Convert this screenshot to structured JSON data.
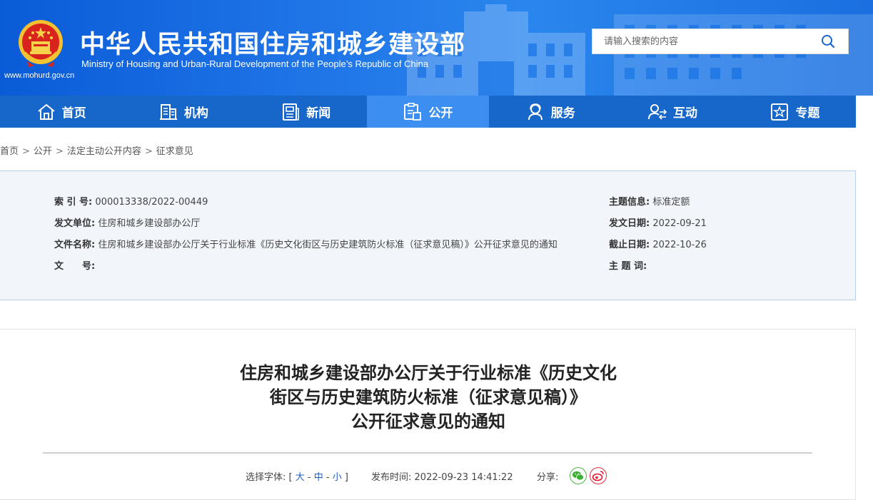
{
  "header": {
    "title": "中华人民共和国住房和城乡建设部",
    "subtitle": "Ministry of Housing and Urban-Rural Development of the People’s Republic of China",
    "url": "www.mohurd.gov.cn",
    "search_placeholder": "请输入搜索的内容"
  },
  "nav": {
    "items": [
      {
        "label": "首页",
        "icon": "home-icon"
      },
      {
        "label": "机构",
        "icon": "building-icon"
      },
      {
        "label": "新闻",
        "icon": "news-icon"
      },
      {
        "label": "公开",
        "icon": "disclosure-icon",
        "active": true
      },
      {
        "label": "服务",
        "icon": "service-icon"
      },
      {
        "label": "互动",
        "icon": "interaction-icon"
      },
      {
        "label": "专题",
        "icon": "topic-icon"
      }
    ]
  },
  "breadcrumb": [
    "首页",
    "公开",
    "法定主动公开内容",
    "征求意见"
  ],
  "info": {
    "index_label": "索 引 号:",
    "index_value": "000013338/2022-00449",
    "issuer_label": "发文单位:",
    "issuer_value": "住房和城乡建设部办公厅",
    "filename_label": "文件名称:",
    "filename_value": "住房和城乡建设部办公厅关于行业标准《历史文化街区与历史建筑防火标准（征求意见稿）》公开征求意见的通知",
    "docno_label": "文　　号:",
    "docno_value": "",
    "topic_label": "主题信息:",
    "topic_value": "标准定额",
    "date_label": "发文日期:",
    "date_value": "2022-09-21",
    "deadline_label": "截止日期:",
    "deadline_value": "2022-10-26",
    "keywords_label": "主 题 词:",
    "keywords_value": ""
  },
  "article": {
    "title_line1": "住房和城乡建设部办公厅关于行业标准《历史文化",
    "title_line2": "街区与历史建筑防火标准（征求意见稿）》",
    "title_line3": "公开征求意见的通知",
    "font_select_label": "选择字体:",
    "font_bracket_open": "[",
    "font_large": "大",
    "font_medium": "中",
    "font_small": "小",
    "font_dash": "-",
    "font_bracket_close": "]",
    "publish_label": "发布时间:",
    "publish_time": "2022-09-23 14:41:22",
    "share_label": "分享:"
  },
  "colors": {
    "banner_blue": "#1f74e6",
    "nav_blue": "#1667c9",
    "nav_active": "#3c8ef0",
    "wechat_green": "#3cb034",
    "weibo_red": "#e6162d"
  }
}
